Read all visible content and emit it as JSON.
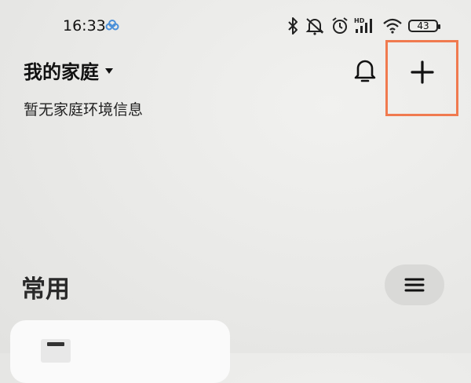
{
  "status_bar": {
    "time": "16:33",
    "battery": "43",
    "icons": [
      "cloud-icon",
      "bluetooth-icon",
      "mute-icon",
      "alarm-icon",
      "hd-signal-icon",
      "wifi-icon",
      "battery-icon"
    ]
  },
  "header": {
    "home_title": "我的家庭",
    "subtitle": "暂无家庭环境信息"
  },
  "section": {
    "title": "常用"
  },
  "colors": {
    "highlight": "#f07a4f",
    "text": "#111111",
    "pill": "#d9d9d7"
  }
}
